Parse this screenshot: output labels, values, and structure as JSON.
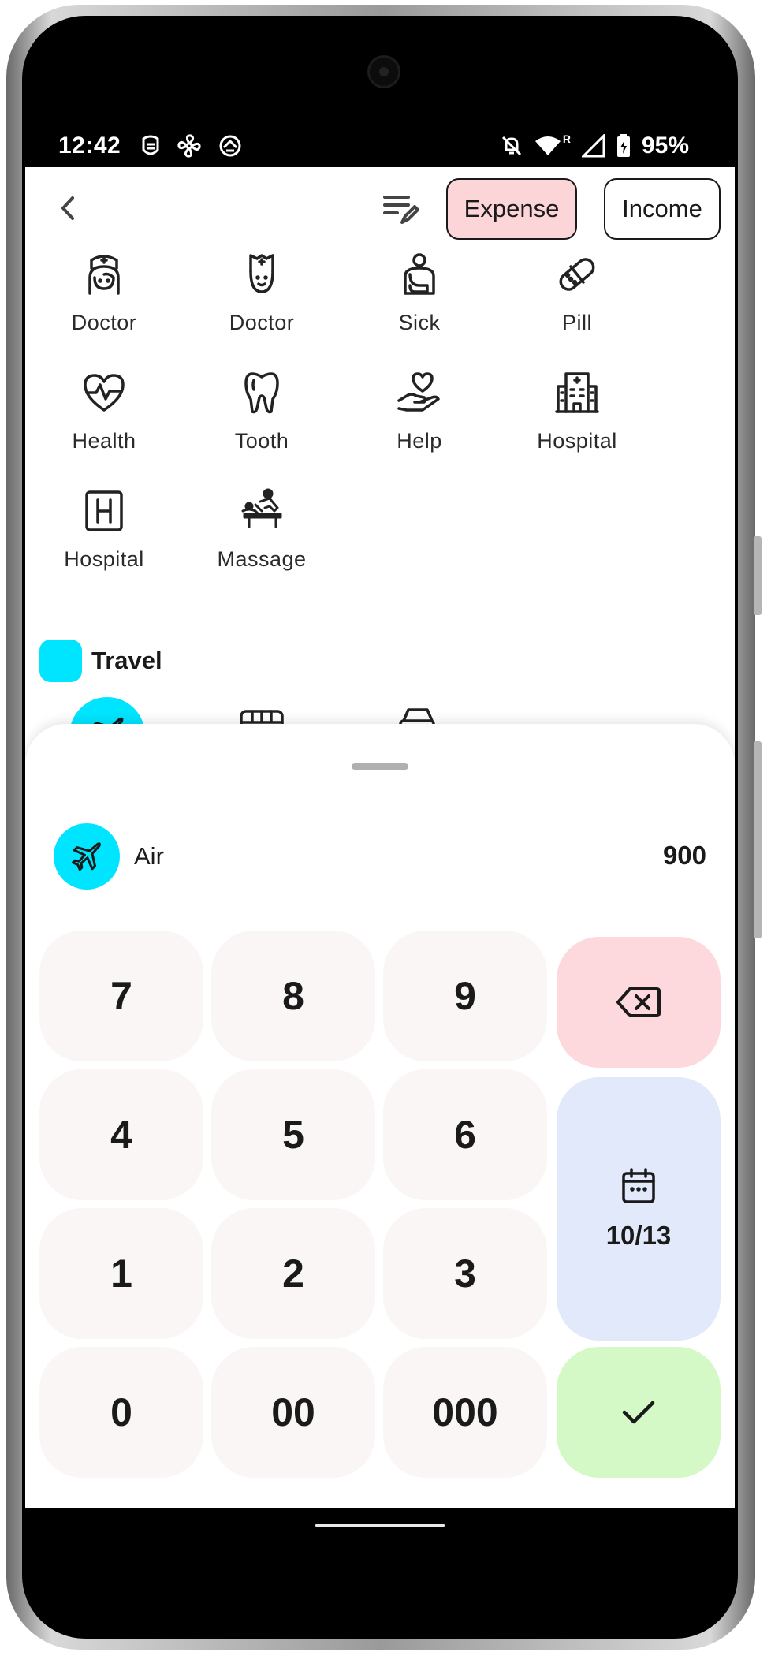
{
  "status_bar": {
    "time": "12:42",
    "left_icons": [
      "face-mask-icon",
      "fan-icon",
      "sync-icon"
    ],
    "right_icons": [
      "bell-off-icon",
      "wifi-icon",
      "signal-icon",
      "battery-charging-icon"
    ],
    "roaming_mark": "R",
    "battery": "95%"
  },
  "header": {
    "back_icon": "chevron-left-icon",
    "edit_icon": "list-edit-icon",
    "expense_label": "Expense",
    "income_label": "Income",
    "active_tab": "Expense"
  },
  "categories": [
    {
      "label": "Doctor",
      "icon": "nurse-female-icon"
    },
    {
      "label": "Doctor",
      "icon": "nurse-male-icon"
    },
    {
      "label": "Sick",
      "icon": "sick-arm-sling-icon"
    },
    {
      "label": "Pill",
      "icon": "pill-bandage-icon"
    },
    {
      "label": "Health",
      "icon": "heart-pulse-icon"
    },
    {
      "label": "Tooth",
      "icon": "tooth-icon"
    },
    {
      "label": "Help",
      "icon": "hand-heart-icon"
    },
    {
      "label": "Hospital",
      "icon": "hospital-building-icon"
    },
    {
      "label": "Hospital",
      "icon": "hospital-sign-icon"
    },
    {
      "label": "Massage",
      "icon": "massage-icon"
    }
  ],
  "travel_group": {
    "title": "Travel",
    "color": "#00e5ff",
    "items": [
      {
        "icon": "airplane-icon",
        "selected": true
      },
      {
        "icon": "bus-icon",
        "selected": false
      },
      {
        "icon": "car-dollar-icon",
        "selected": false
      }
    ]
  },
  "entry": {
    "category_name": "Air",
    "category_icon": "airplane-icon",
    "amount": "900"
  },
  "keypad": {
    "keys": [
      "7",
      "8",
      "9",
      "4",
      "5",
      "6",
      "1",
      "2",
      "3",
      "0",
      "00",
      "000"
    ],
    "backspace_icon": "backspace-icon",
    "calendar_icon": "calendar-icon",
    "date": "10/13",
    "confirm_icon": "check-icon"
  },
  "colors": {
    "expense_bg": "#fcd5d9",
    "accent_cyan": "#00e5ff",
    "key_bg": "#f9f6f5",
    "delete_bg": "#fdd8dc",
    "date_bg": "#e2e9fb",
    "confirm_bg": "#d4f8c6"
  }
}
